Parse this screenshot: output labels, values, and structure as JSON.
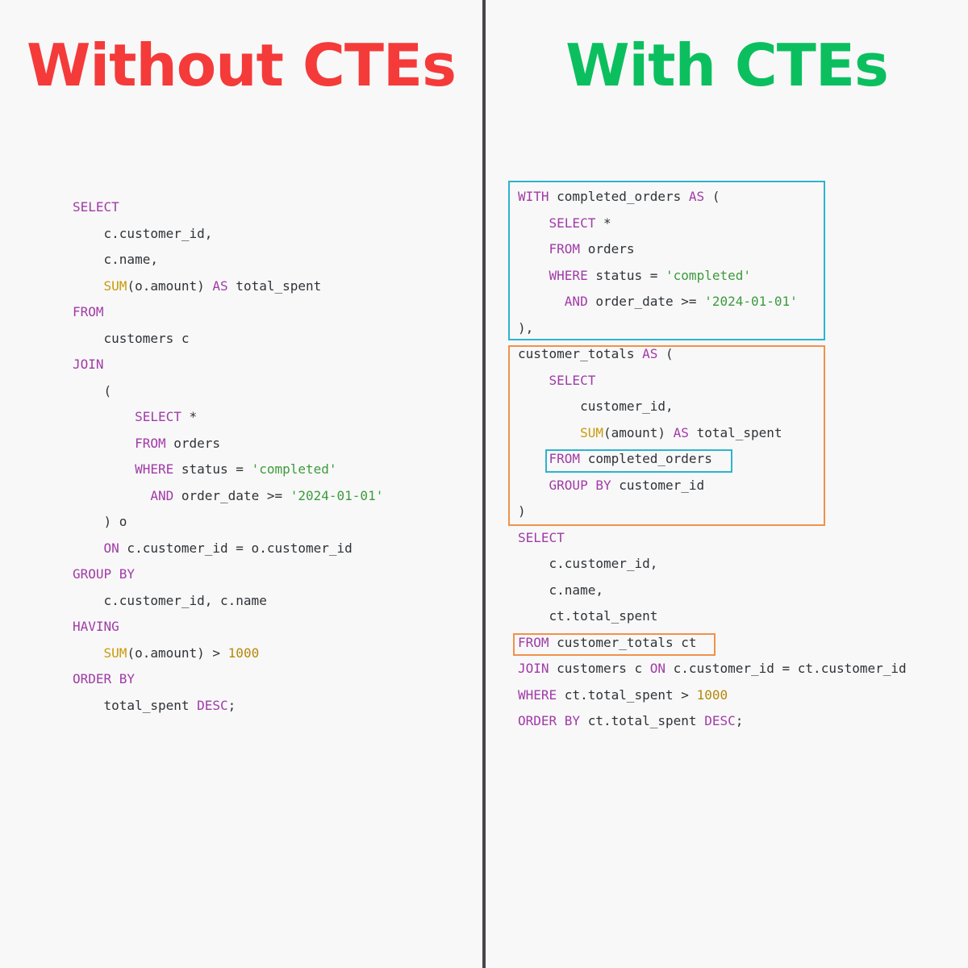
{
  "headings": {
    "left": "Without CTEs",
    "right": "With CTEs"
  },
  "colors": {
    "left_heading": "#f53a3a",
    "right_heading": "#0bbf5f",
    "keyword": "#a03ba7",
    "function": "#c99a08",
    "string": "#3c9b3c",
    "number": "#b5880a",
    "identifier": "#2f3337",
    "cte_box": "#2db3cf",
    "totals_box": "#f0924a",
    "divider": "#4a454b"
  },
  "left_code": [
    [
      {
        "t": "SELECT",
        "c": "kw"
      }
    ],
    [
      {
        "t": "    c.customer_id,"
      }
    ],
    [
      {
        "t": "    c.name,"
      }
    ],
    [
      {
        "t": "    "
      },
      {
        "t": "SUM",
        "c": "fn"
      },
      {
        "t": "(o.amount) "
      },
      {
        "t": "AS",
        "c": "kw"
      },
      {
        "t": " total_spent"
      }
    ],
    [
      {
        "t": "FROM",
        "c": "kw"
      }
    ],
    [
      {
        "t": "    customers c"
      }
    ],
    [
      {
        "t": "JOIN",
        "c": "kw"
      }
    ],
    [
      {
        "t": "    ("
      }
    ],
    [
      {
        "t": "        "
      },
      {
        "t": "SELECT",
        "c": "kw"
      },
      {
        "t": " *"
      }
    ],
    [
      {
        "t": "        "
      },
      {
        "t": "FROM",
        "c": "kw"
      },
      {
        "t": " orders"
      }
    ],
    [
      {
        "t": "        "
      },
      {
        "t": "WHERE",
        "c": "kw"
      },
      {
        "t": " status = "
      },
      {
        "t": "'completed'",
        "c": "str"
      }
    ],
    [
      {
        "t": "          "
      },
      {
        "t": "AND",
        "c": "kw"
      },
      {
        "t": " order_date >= "
      },
      {
        "t": "'2024-01-01'",
        "c": "str"
      }
    ],
    [
      {
        "t": "    ) o"
      }
    ],
    [
      {
        "t": "    "
      },
      {
        "t": "ON",
        "c": "kw"
      },
      {
        "t": " c.customer_id = o.customer_id"
      }
    ],
    [
      {
        "t": "GROUP BY",
        "c": "kw"
      }
    ],
    [
      {
        "t": "    c.customer_id, c.name"
      }
    ],
    [
      {
        "t": "HAVING",
        "c": "kw"
      }
    ],
    [
      {
        "t": "    "
      },
      {
        "t": "SUM",
        "c": "fn"
      },
      {
        "t": "(o.amount) > "
      },
      {
        "t": "1000",
        "c": "num"
      }
    ],
    [
      {
        "t": "ORDER BY",
        "c": "kw"
      }
    ],
    [
      {
        "t": "    total_spent "
      },
      {
        "t": "DESC",
        "c": "kw"
      },
      {
        "t": ";"
      }
    ]
  ],
  "right_code": [
    [
      {
        "t": "WITH",
        "c": "kw"
      },
      {
        "t": " completed_orders "
      },
      {
        "t": "AS",
        "c": "kw"
      },
      {
        "t": " ("
      }
    ],
    [
      {
        "t": "    "
      },
      {
        "t": "SELECT",
        "c": "kw"
      },
      {
        "t": " *"
      }
    ],
    [
      {
        "t": "    "
      },
      {
        "t": "FROM",
        "c": "kw"
      },
      {
        "t": " orders"
      }
    ],
    [
      {
        "t": "    "
      },
      {
        "t": "WHERE",
        "c": "kw"
      },
      {
        "t": " status = "
      },
      {
        "t": "'completed'",
        "c": "str"
      }
    ],
    [
      {
        "t": "      "
      },
      {
        "t": "AND",
        "c": "kw"
      },
      {
        "t": " order_date >= "
      },
      {
        "t": "'2024-01-01'",
        "c": "str"
      }
    ],
    [
      {
        "t": "),"
      }
    ],
    [
      {
        "t": "customer_totals "
      },
      {
        "t": "AS",
        "c": "kw"
      },
      {
        "t": " ("
      }
    ],
    [
      {
        "t": "    "
      },
      {
        "t": "SELECT",
        "c": "kw"
      }
    ],
    [
      {
        "t": "        customer_id,"
      }
    ],
    [
      {
        "t": "        "
      },
      {
        "t": "SUM",
        "c": "fn"
      },
      {
        "t": "(amount) "
      },
      {
        "t": "AS",
        "c": "kw"
      },
      {
        "t": " total_spent"
      }
    ],
    [
      {
        "t": "    "
      },
      {
        "t": "FROM",
        "c": "kw"
      },
      {
        "t": " completed_orders"
      }
    ],
    [
      {
        "t": "    "
      },
      {
        "t": "GROUP BY",
        "c": "kw"
      },
      {
        "t": " customer_id"
      }
    ],
    [
      {
        "t": ")"
      }
    ],
    [
      {
        "t": "SELECT",
        "c": "kw"
      }
    ],
    [
      {
        "t": "    c.customer_id,"
      }
    ],
    [
      {
        "t": "    c.name,"
      }
    ],
    [
      {
        "t": "    ct.total_spent"
      }
    ],
    [
      {
        "t": "FROM",
        "c": "kw"
      },
      {
        "t": " customer_totals ct"
      }
    ],
    [
      {
        "t": "JOIN",
        "c": "kw"
      },
      {
        "t": " customers c "
      },
      {
        "t": "ON",
        "c": "kw"
      },
      {
        "t": " c.customer_id = ct.customer_id"
      }
    ],
    [
      {
        "t": "WHERE",
        "c": "kw"
      },
      {
        "t": " ct.total_spent > "
      },
      {
        "t": "1000",
        "c": "num"
      }
    ],
    [
      {
        "t": "ORDER BY",
        "c": "kw"
      },
      {
        "t": " ct.total_spent "
      },
      {
        "t": "DESC",
        "c": "kw"
      },
      {
        "t": ";"
      }
    ]
  ]
}
